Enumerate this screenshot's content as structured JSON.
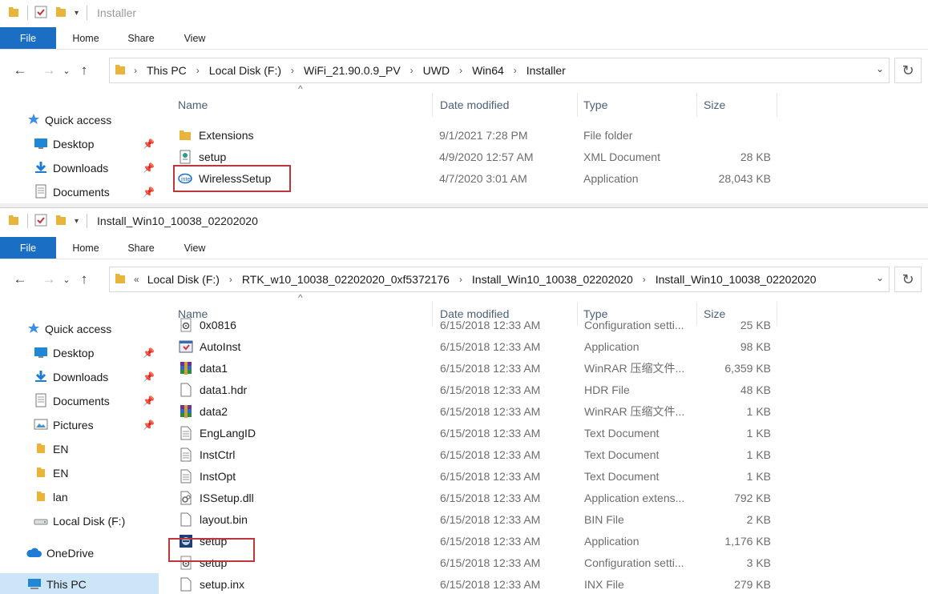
{
  "win1": {
    "title": "Installer",
    "ribbon": [
      "File",
      "Home",
      "Share",
      "View"
    ],
    "crumbs": [
      "This PC",
      "Local Disk (F:)",
      "WiFi_21.90.0.9_PV",
      "UWD",
      "Win64",
      "Installer"
    ],
    "sidebar": [
      {
        "label": "Quick access",
        "icon": "star-icon",
        "pin": false
      },
      {
        "label": "Desktop",
        "icon": "desktop-icon",
        "pin": true
      },
      {
        "label": "Downloads",
        "icon": "download-icon",
        "pin": true
      },
      {
        "label": "Documents",
        "icon": "document-icon",
        "pin": true
      }
    ],
    "columns": [
      "Name",
      "Date modified",
      "Type",
      "Size"
    ],
    "files": [
      {
        "name": "Extensions",
        "date": "9/1/2021 7:28 PM",
        "type": "File folder",
        "size": "",
        "icon": "folder-icon"
      },
      {
        "name": "setup",
        "date": "4/9/2020 12:57 AM",
        "type": "XML Document",
        "size": "28 KB",
        "icon": "xml-icon"
      },
      {
        "name": "WirelessSetup",
        "date": "4/7/2020 3:01 AM",
        "type": "Application",
        "size": "28,043 KB",
        "icon": "intel-icon"
      }
    ]
  },
  "win2": {
    "title": "Install_Win10_10038_02202020",
    "ribbon": [
      "File",
      "Home",
      "Share",
      "View"
    ],
    "overflow": "«",
    "crumbs": [
      "Local Disk (F:)",
      "RTK_w10_10038_02202020_0xf5372176",
      "Install_Win10_10038_02202020",
      "Install_Win10_10038_02202020"
    ],
    "sidebar": [
      {
        "label": "Quick access",
        "icon": "star-icon",
        "pin": false
      },
      {
        "label": "Desktop",
        "icon": "desktop-icon",
        "pin": true
      },
      {
        "label": "Downloads",
        "icon": "download-icon",
        "pin": true
      },
      {
        "label": "Documents",
        "icon": "document-icon",
        "pin": true
      },
      {
        "label": "Pictures",
        "icon": "pictures-icon",
        "pin": true
      },
      {
        "label": "EN",
        "icon": "folder-icon",
        "pin": false
      },
      {
        "label": "EN",
        "icon": "folder-icon",
        "pin": false
      },
      {
        "label": "lan",
        "icon": "folder-icon",
        "pin": false
      },
      {
        "label": "Local Disk (F:)",
        "icon": "drive-icon",
        "pin": false
      },
      {
        "label": "OneDrive",
        "icon": "cloud-icon",
        "pin": false
      },
      {
        "label": "This PC",
        "icon": "computer-icon",
        "pin": false
      }
    ],
    "columns": [
      "Name",
      "Date modified",
      "Type",
      "Size"
    ],
    "files": [
      {
        "name": "0x0816",
        "date": "6/15/2018 12:33 AM",
        "type": "Configuration setti...",
        "size": "25 KB",
        "icon": "config-icon"
      },
      {
        "name": "AutoInst",
        "date": "6/15/2018 12:33 AM",
        "type": "Application",
        "size": "98 KB",
        "icon": "app-icon"
      },
      {
        "name": "data1",
        "date": "6/15/2018 12:33 AM",
        "type": "WinRAR 压缩文件...",
        "size": "6,359 KB",
        "icon": "winrar-icon"
      },
      {
        "name": "data1.hdr",
        "date": "6/15/2018 12:33 AM",
        "type": "HDR File",
        "size": "48 KB",
        "icon": "file-icon"
      },
      {
        "name": "data2",
        "date": "6/15/2018 12:33 AM",
        "type": "WinRAR 压缩文件...",
        "size": "1 KB",
        "icon": "winrar-icon"
      },
      {
        "name": "EngLangID",
        "date": "6/15/2018 12:33 AM",
        "type": "Text Document",
        "size": "1 KB",
        "icon": "text-file-icon"
      },
      {
        "name": "InstCtrl",
        "date": "6/15/2018 12:33 AM",
        "type": "Text Document",
        "size": "1 KB",
        "icon": "text-file-icon"
      },
      {
        "name": "InstOpt",
        "date": "6/15/2018 12:33 AM",
        "type": "Text Document",
        "size": "1 KB",
        "icon": "text-file-icon"
      },
      {
        "name": "ISSetup.dll",
        "date": "6/15/2018 12:33 AM",
        "type": "Application extens...",
        "size": "792 KB",
        "icon": "dll-icon"
      },
      {
        "name": "layout.bin",
        "date": "6/15/2018 12:33 AM",
        "type": "BIN File",
        "size": "2 KB",
        "icon": "file-icon"
      },
      {
        "name": "setup",
        "date": "6/15/2018 12:33 AM",
        "type": "Application",
        "size": "1,176 KB",
        "icon": "setup-app-icon"
      },
      {
        "name": "setup",
        "date": "6/15/2018 12:33 AM",
        "type": "Configuration setti...",
        "size": "3 KB",
        "icon": "config-icon"
      },
      {
        "name": "setup.inx",
        "date": "6/15/2018 12:33 AM",
        "type": "INX File",
        "size": "279 KB",
        "icon": "file-icon"
      }
    ]
  },
  "colors": {
    "accent": "#1a6fc4",
    "highlight": "#c0353a",
    "folder": "#e8b53a",
    "selected": "#cde6f7"
  }
}
